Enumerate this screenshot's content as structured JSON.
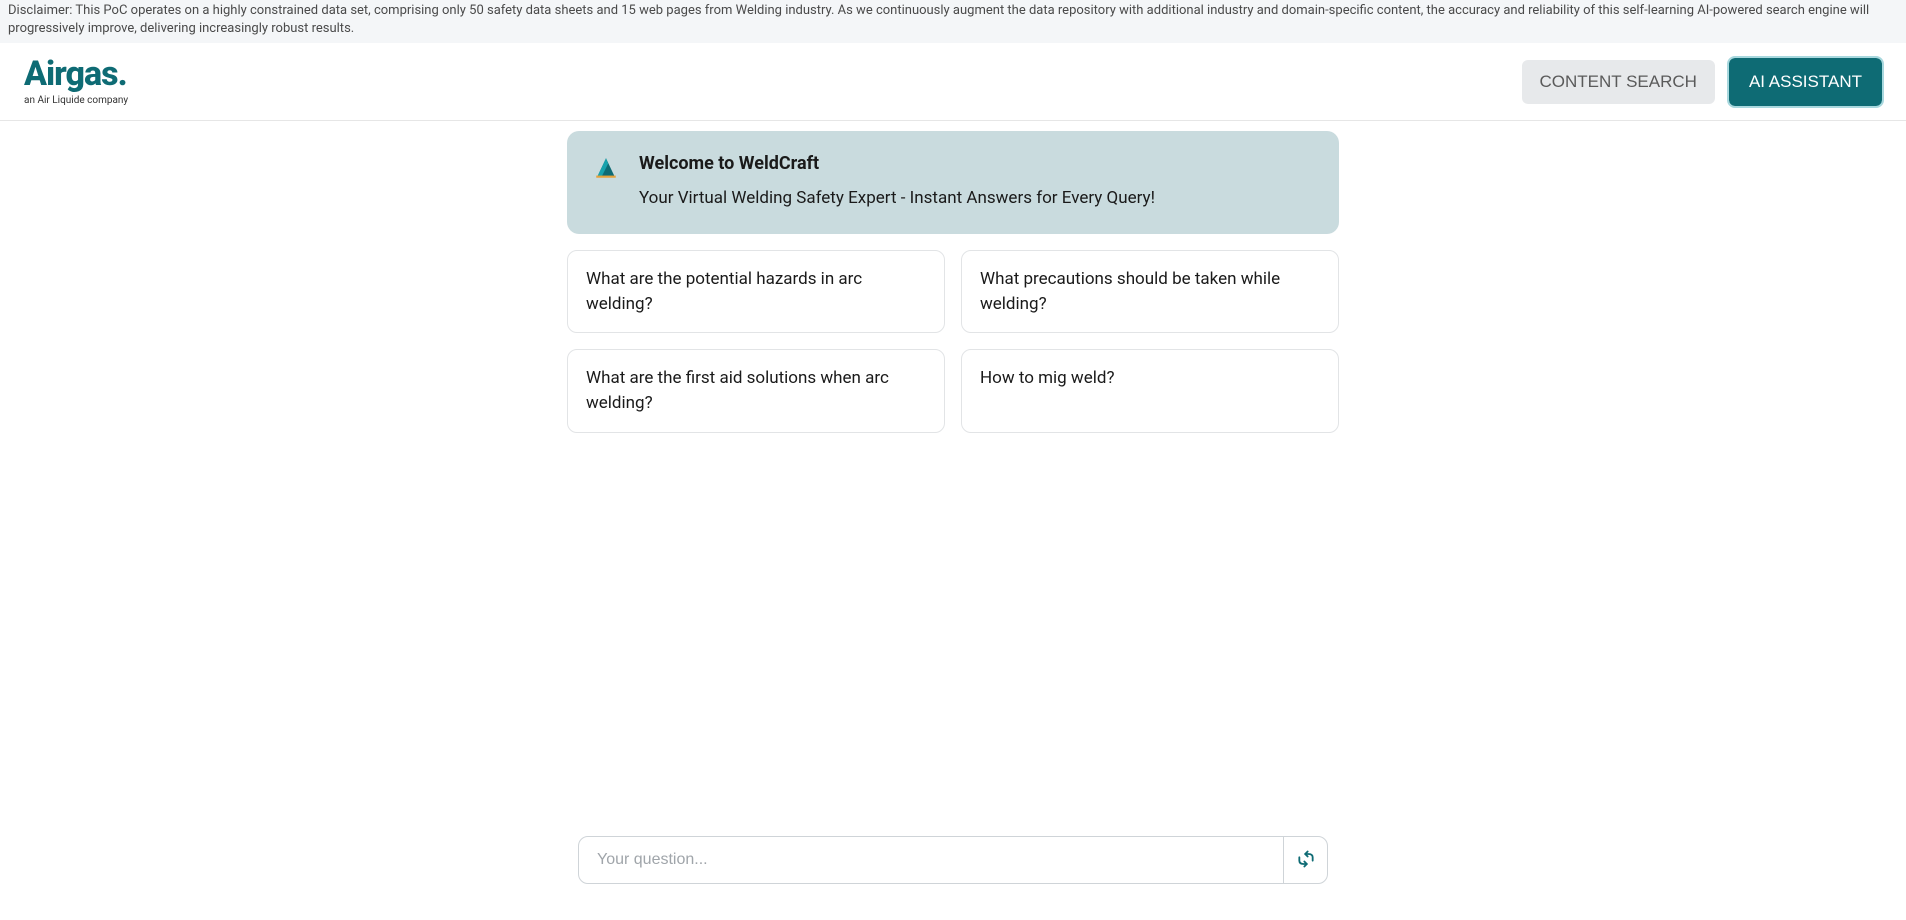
{
  "disclaimer": "Disclaimer: This PoC operates on a highly constrained data set, comprising only 50 safety data sheets and 15 web pages from Welding industry. As we continuously augment the data repository with additional industry and domain-specific content, the accuracy and reliability of this self-learning AI-powered search engine will progressively improve, delivering increasingly robust results.",
  "logo": {
    "main": "Airgas",
    "sub": "an Air Liquide company"
  },
  "header": {
    "content_search_label": "CONTENT SEARCH",
    "ai_assistant_label": "AI ASSISTANT"
  },
  "welcome": {
    "title": "Welcome to WeldCraft",
    "subtitle": "Your Virtual Welding Safety Expert - Instant Answers for Every Query!"
  },
  "suggestions": [
    "What are the potential hazards in arc welding?",
    "What precautions should be taken while welding?",
    "What are the first aid solutions when arc welding?",
    "How to mig weld?"
  ],
  "input": {
    "placeholder": "Your question...",
    "value": ""
  },
  "colors": {
    "brand": "#0e6b74"
  }
}
